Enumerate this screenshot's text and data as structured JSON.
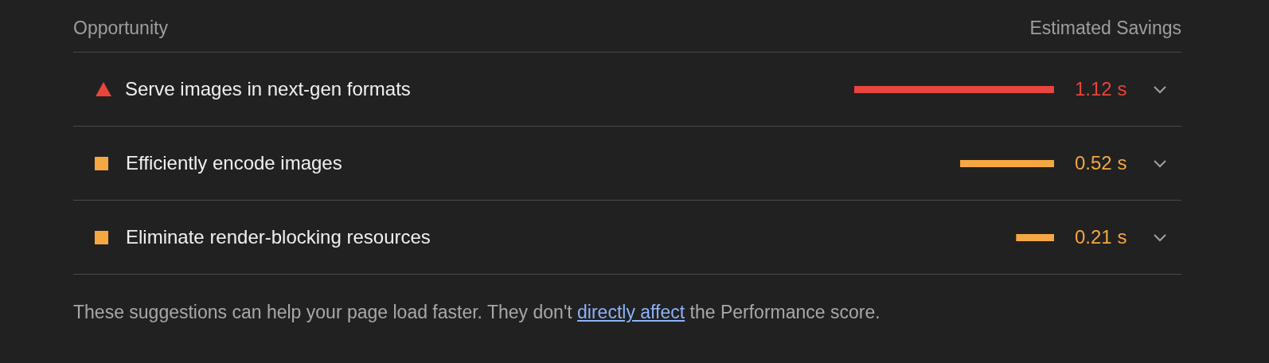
{
  "header": {
    "column_1": "Opportunity",
    "column_2": "Estimated Savings"
  },
  "opportunities": [
    {
      "kind": "fail",
      "title": "Serve images in next-gen formats",
      "level": 1.0,
      "savings": "1.12 s",
      "expanded": false
    },
    {
      "kind": "average",
      "title": "Efficiently encode images",
      "level": 0.47,
      "savings": "0.52 s",
      "expanded": false
    },
    {
      "kind": "average",
      "title": "Eliminate render-blocking resources",
      "level": 0.19,
      "savings": "0.21 s",
      "expanded": false
    }
  ],
  "footer": {
    "text_before": "These suggestions can help your page load faster. They don't ",
    "link": "directly affect",
    "text_after": " the Performance score."
  }
}
